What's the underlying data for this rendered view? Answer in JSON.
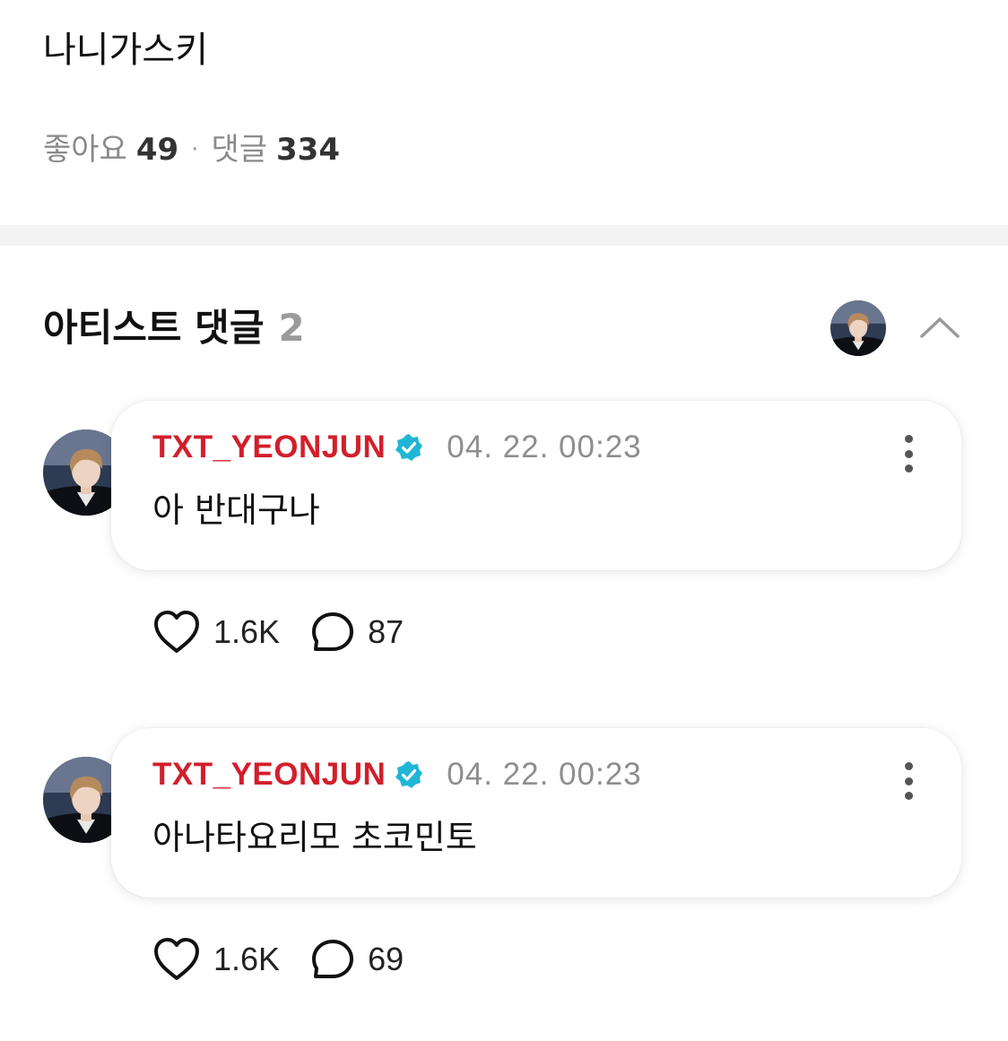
{
  "post": {
    "text": "나니가스키",
    "likes_label": "좋아요",
    "likes_count": "49",
    "separator": "·",
    "comments_label": "댓글",
    "comments_count": "334"
  },
  "artist_comments": {
    "title": "아티스트 댓글",
    "count": "2",
    "collapse_icon": "chevron-up-icon"
  },
  "comments": [
    {
      "author": "TXT_YEONJUN",
      "verified_icon": "verified-badge-icon",
      "timestamp": "04. 22. 00:23",
      "text": "아 반대구나",
      "likes": "1.6K",
      "replies": "87"
    },
    {
      "author": "TXT_YEONJUN",
      "verified_icon": "verified-badge-icon",
      "timestamp": "04. 22. 00:23",
      "text": "아나타요리모 초코민토",
      "likes": "1.6K",
      "replies": "69"
    }
  ],
  "colors": {
    "author": "#d21f2b",
    "verified": "#1fb6d6",
    "muted": "#8e8e8e",
    "divider": "#f3f3f3"
  }
}
